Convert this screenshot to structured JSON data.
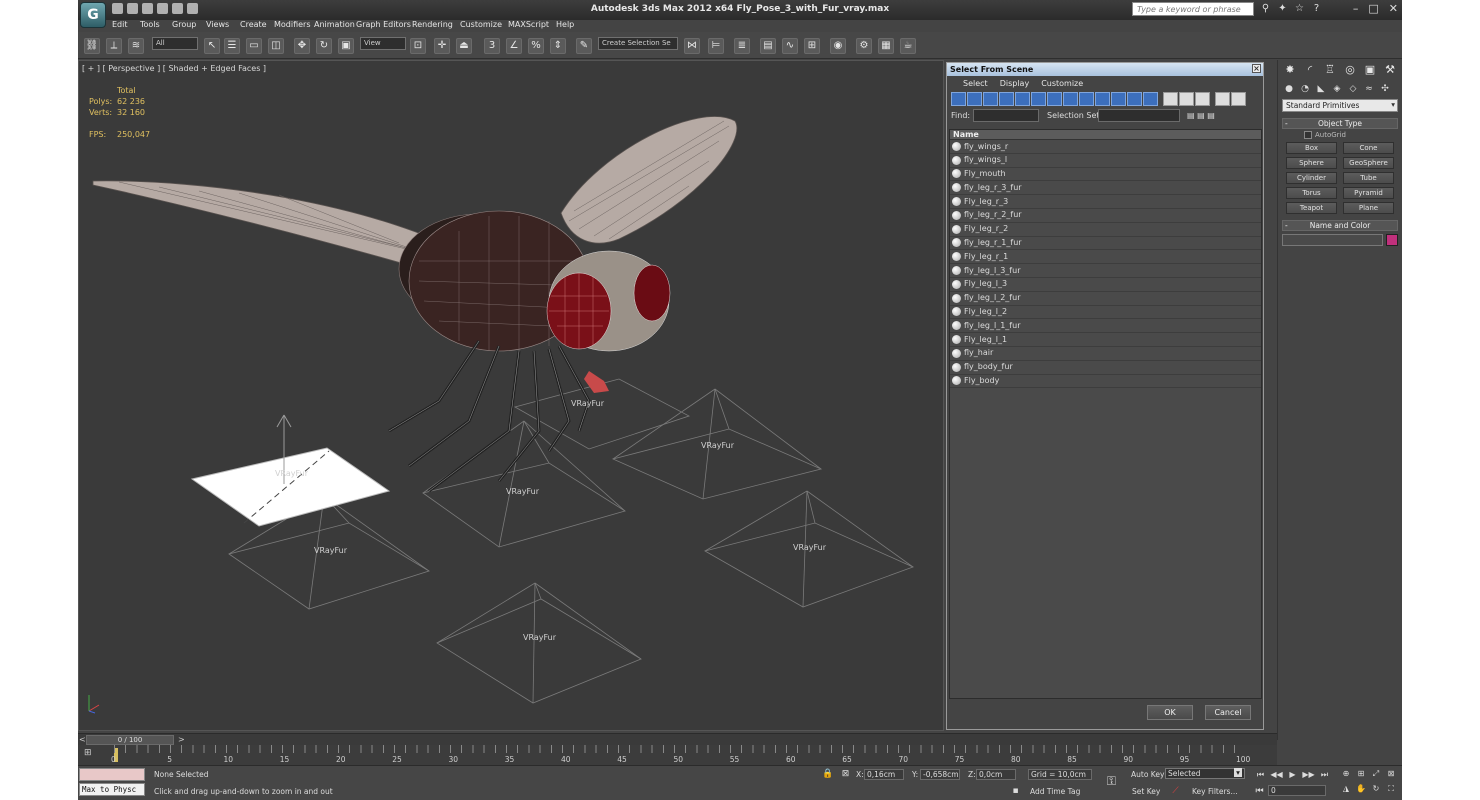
{
  "window": {
    "title": "Autodesk 3ds Max  2012 x64     Fly_Pose_3_with_Fur_vray.max",
    "search_placeholder": "Type a keyword or phrase",
    "app_logo": "G"
  },
  "menu": [
    "Edit",
    "Tools",
    "Group",
    "Views",
    "Create",
    "Modifiers",
    "Animation",
    "Graph Editors",
    "Rendering",
    "Customize",
    "MAXScript",
    "Help"
  ],
  "toolbar": {
    "selection_filter": "All",
    "reference_coord": "View",
    "named_selection": "Create Selection Se",
    "snap_label": "3",
    "percent_snap": "%"
  },
  "viewport": {
    "label": "[ + ] [ Perspective ] [ Shaded + Edged Faces ]",
    "stats": {
      "total_label": "Total",
      "polys_label": "Polys:",
      "polys_value": "62 236",
      "verts_label": "Verts:",
      "verts_value": "32 160",
      "fps_label": "FPS:",
      "fps_value": "250,047"
    },
    "vrayfur_labels": [
      "VRayFur",
      "VRayFur",
      "VRayFur",
      "VRayFur",
      "VRayFur",
      "VRayFur",
      "VRayFur"
    ]
  },
  "dialog": {
    "title": "Select From Scene",
    "menu": [
      "Select",
      "Display",
      "Customize"
    ],
    "find_label": "Find:",
    "selection_set_label": "Selection Set:",
    "column_header": "Name",
    "objects": [
      "fly_wings_r",
      "fly_wings_l",
      "Fly_mouth",
      "fly_leg_r_3_fur",
      "Fly_leg_r_3",
      "fly_leg_r_2_fur",
      "Fly_leg_r_2",
      "fly_leg_r_1_fur",
      "Fly_leg_r_1",
      "fly_leg_l_3_fur",
      "Fly_leg_l_3",
      "fly_leg_l_2_fur",
      "Fly_leg_l_2",
      "fly_leg_l_1_fur",
      "Fly_leg_l_1",
      "fly_hair",
      "fly_body_fur",
      "Fly_body"
    ],
    "ok_label": "OK",
    "cancel_label": "Cancel"
  },
  "command_panel": {
    "category": "Standard Primitives",
    "object_type_title": "Object Type",
    "autogrid_label": "AutoGrid",
    "primitives": [
      "Box",
      "Cone",
      "Sphere",
      "GeoSphere",
      "Cylinder",
      "Tube",
      "Torus",
      "Pyramid",
      "Teapot",
      "Plane"
    ],
    "name_color_title": "Name and Color",
    "object_color": "#c0307c"
  },
  "timeline": {
    "frame_display": "0 / 100",
    "ticks": [
      "0",
      "5",
      "10",
      "15",
      "20",
      "25",
      "30",
      "35",
      "40",
      "45",
      "50",
      "55",
      "60",
      "65",
      "70",
      "75",
      "80",
      "85",
      "90",
      "95",
      "100"
    ]
  },
  "status": {
    "maxscript_listener": "Max to Physc",
    "selection_status": "None Selected",
    "prompt": "Click and drag up-and-down to zoom in and out",
    "x_label": "X:",
    "x_value": "0,16cm",
    "y_label": "Y:",
    "y_value": "-0,658cm",
    "z_label": "Z:",
    "z_value": "0,0cm",
    "grid": "Grid = 10,0cm",
    "add_time_tag": "Add Time Tag",
    "auto_key": "Auto Key",
    "set_key": "Set Key",
    "key_mode": "Selected",
    "key_filters": "Key Filters...",
    "current_frame": "0"
  }
}
